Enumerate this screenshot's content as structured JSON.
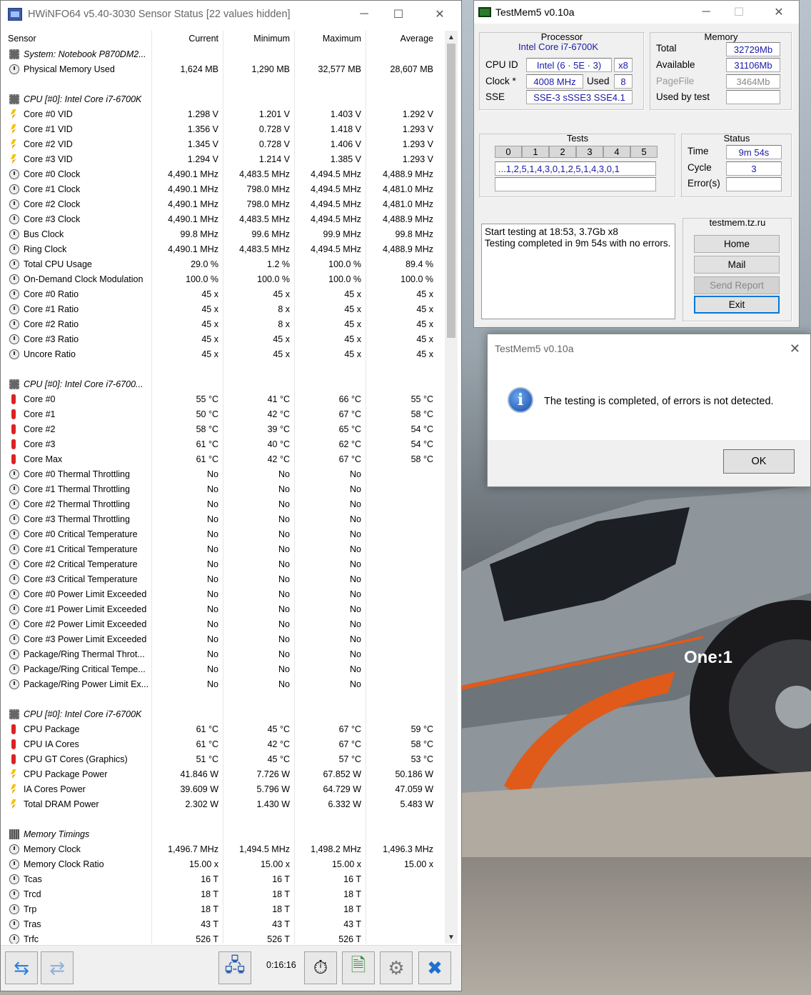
{
  "hwinfo": {
    "title": "HWiNFO64 v5.40-3030 Sensor Status [22 values hidden]",
    "columns": [
      "Sensor",
      "Current",
      "Minimum",
      "Maximum",
      "Average"
    ],
    "uptime": "0:16:16",
    "rows": [
      {
        "type": "group",
        "icon": "chip-icon",
        "name": "System: Notebook P870DM2..."
      },
      {
        "type": "data",
        "icon": "clock-icon",
        "name": "Physical Memory Used",
        "cur": "1,624 MB",
        "min": "1,290 MB",
        "max": "32,577 MB",
        "avg": "28,607 MB"
      },
      {
        "type": "blank"
      },
      {
        "type": "group",
        "icon": "chip-icon",
        "name": "CPU [#0]: Intel Core i7-6700K"
      },
      {
        "type": "data",
        "icon": "voltage-icon",
        "name": "Core #0 VID",
        "cur": "1.298 V",
        "min": "1.201 V",
        "max": "1.403 V",
        "avg": "1.292 V"
      },
      {
        "type": "data",
        "icon": "voltage-icon",
        "name": "Core #1 VID",
        "cur": "1.356 V",
        "min": "0.728 V",
        "max": "1.418 V",
        "avg": "1.293 V"
      },
      {
        "type": "data",
        "icon": "voltage-icon",
        "name": "Core #2 VID",
        "cur": "1.345 V",
        "min": "0.728 V",
        "max": "1.406 V",
        "avg": "1.293 V"
      },
      {
        "type": "data",
        "icon": "voltage-icon",
        "name": "Core #3 VID",
        "cur": "1.294 V",
        "min": "1.214 V",
        "max": "1.385 V",
        "avg": "1.293 V"
      },
      {
        "type": "data",
        "icon": "clock-icon",
        "name": "Core #0 Clock",
        "cur": "4,490.1 MHz",
        "min": "4,483.5 MHz",
        "max": "4,494.5 MHz",
        "avg": "4,488.9 MHz"
      },
      {
        "type": "data",
        "icon": "clock-icon",
        "name": "Core #1 Clock",
        "cur": "4,490.1 MHz",
        "min": "798.0 MHz",
        "max": "4,494.5 MHz",
        "avg": "4,481.0 MHz"
      },
      {
        "type": "data",
        "icon": "clock-icon",
        "name": "Core #2 Clock",
        "cur": "4,490.1 MHz",
        "min": "798.0 MHz",
        "max": "4,494.5 MHz",
        "avg": "4,481.0 MHz"
      },
      {
        "type": "data",
        "icon": "clock-icon",
        "name": "Core #3 Clock",
        "cur": "4,490.1 MHz",
        "min": "4,483.5 MHz",
        "max": "4,494.5 MHz",
        "avg": "4,488.9 MHz"
      },
      {
        "type": "data",
        "icon": "clock-icon",
        "name": "Bus Clock",
        "cur": "99.8 MHz",
        "min": "99.6 MHz",
        "max": "99.9 MHz",
        "avg": "99.8 MHz"
      },
      {
        "type": "data",
        "icon": "clock-icon",
        "name": "Ring Clock",
        "cur": "4,490.1 MHz",
        "min": "4,483.5 MHz",
        "max": "4,494.5 MHz",
        "avg": "4,488.9 MHz"
      },
      {
        "type": "data",
        "icon": "clock-icon",
        "name": "Total CPU Usage",
        "cur": "29.0 %",
        "min": "1.2 %",
        "max": "100.0 %",
        "avg": "89.4 %"
      },
      {
        "type": "data",
        "icon": "clock-icon",
        "name": "On-Demand Clock Modulation",
        "cur": "100.0 %",
        "min": "100.0 %",
        "max": "100.0 %",
        "avg": "100.0 %"
      },
      {
        "type": "data",
        "icon": "clock-icon",
        "name": "Core #0 Ratio",
        "cur": "45 x",
        "min": "45 x",
        "max": "45 x",
        "avg": "45 x"
      },
      {
        "type": "data",
        "icon": "clock-icon",
        "name": "Core #1 Ratio",
        "cur": "45 x",
        "min": "8 x",
        "max": "45 x",
        "avg": "45 x"
      },
      {
        "type": "data",
        "icon": "clock-icon",
        "name": "Core #2 Ratio",
        "cur": "45 x",
        "min": "8 x",
        "max": "45 x",
        "avg": "45 x"
      },
      {
        "type": "data",
        "icon": "clock-icon",
        "name": "Core #3 Ratio",
        "cur": "45 x",
        "min": "45 x",
        "max": "45 x",
        "avg": "45 x"
      },
      {
        "type": "data",
        "icon": "clock-icon",
        "name": "Uncore Ratio",
        "cur": "45 x",
        "min": "45 x",
        "max": "45 x",
        "avg": "45 x"
      },
      {
        "type": "blank"
      },
      {
        "type": "group",
        "icon": "chip-icon",
        "name": "CPU [#0]: Intel Core i7-6700..."
      },
      {
        "type": "data",
        "icon": "temperature-icon",
        "name": "Core #0",
        "cur": "55 °C",
        "min": "41 °C",
        "max": "66 °C",
        "avg": "55 °C"
      },
      {
        "type": "data",
        "icon": "temperature-icon",
        "name": "Core #1",
        "cur": "50 °C",
        "min": "42 °C",
        "max": "67 °C",
        "avg": "58 °C"
      },
      {
        "type": "data",
        "icon": "temperature-icon",
        "name": "Core #2",
        "cur": "58 °C",
        "min": "39 °C",
        "max": "65 °C",
        "avg": "54 °C"
      },
      {
        "type": "data",
        "icon": "temperature-icon",
        "name": "Core #3",
        "cur": "61 °C",
        "min": "40 °C",
        "max": "62 °C",
        "avg": "54 °C"
      },
      {
        "type": "data",
        "icon": "temperature-icon",
        "name": "Core Max",
        "cur": "61 °C",
        "min": "42 °C",
        "max": "67 °C",
        "avg": "58 °C"
      },
      {
        "type": "data",
        "icon": "clock-icon",
        "name": "Core #0 Thermal Throttling",
        "cur": "No",
        "min": "No",
        "max": "No",
        "avg": ""
      },
      {
        "type": "data",
        "icon": "clock-icon",
        "name": "Core #1 Thermal Throttling",
        "cur": "No",
        "min": "No",
        "max": "No",
        "avg": ""
      },
      {
        "type": "data",
        "icon": "clock-icon",
        "name": "Core #2 Thermal Throttling",
        "cur": "No",
        "min": "No",
        "max": "No",
        "avg": ""
      },
      {
        "type": "data",
        "icon": "clock-icon",
        "name": "Core #3 Thermal Throttling",
        "cur": "No",
        "min": "No",
        "max": "No",
        "avg": ""
      },
      {
        "type": "data",
        "icon": "clock-icon",
        "name": "Core #0 Critical Temperature",
        "cur": "No",
        "min": "No",
        "max": "No",
        "avg": ""
      },
      {
        "type": "data",
        "icon": "clock-icon",
        "name": "Core #1 Critical Temperature",
        "cur": "No",
        "min": "No",
        "max": "No",
        "avg": ""
      },
      {
        "type": "data",
        "icon": "clock-icon",
        "name": "Core #2 Critical Temperature",
        "cur": "No",
        "min": "No",
        "max": "No",
        "avg": ""
      },
      {
        "type": "data",
        "icon": "clock-icon",
        "name": "Core #3 Critical Temperature",
        "cur": "No",
        "min": "No",
        "max": "No",
        "avg": ""
      },
      {
        "type": "data",
        "icon": "clock-icon",
        "name": "Core #0 Power Limit Exceeded",
        "cur": "No",
        "min": "No",
        "max": "No",
        "avg": ""
      },
      {
        "type": "data",
        "icon": "clock-icon",
        "name": "Core #1 Power Limit Exceeded",
        "cur": "No",
        "min": "No",
        "max": "No",
        "avg": ""
      },
      {
        "type": "data",
        "icon": "clock-icon",
        "name": "Core #2 Power Limit Exceeded",
        "cur": "No",
        "min": "No",
        "max": "No",
        "avg": ""
      },
      {
        "type": "data",
        "icon": "clock-icon",
        "name": "Core #3 Power Limit Exceeded",
        "cur": "No",
        "min": "No",
        "max": "No",
        "avg": ""
      },
      {
        "type": "data",
        "icon": "clock-icon",
        "name": "Package/Ring Thermal Throt...",
        "cur": "No",
        "min": "No",
        "max": "No",
        "avg": ""
      },
      {
        "type": "data",
        "icon": "clock-icon",
        "name": "Package/Ring Critical Tempe...",
        "cur": "No",
        "min": "No",
        "max": "No",
        "avg": ""
      },
      {
        "type": "data",
        "icon": "clock-icon",
        "name": "Package/Ring Power Limit Ex...",
        "cur": "No",
        "min": "No",
        "max": "No",
        "avg": ""
      },
      {
        "type": "blank"
      },
      {
        "type": "group",
        "icon": "chip-icon",
        "name": "CPU [#0]: Intel Core i7-6700K"
      },
      {
        "type": "data",
        "icon": "temperature-icon",
        "name": "CPU Package",
        "cur": "61 °C",
        "min": "45 °C",
        "max": "67 °C",
        "avg": "59 °C"
      },
      {
        "type": "data",
        "icon": "temperature-icon",
        "name": "CPU IA Cores",
        "cur": "61 °C",
        "min": "42 °C",
        "max": "67 °C",
        "avg": "58 °C"
      },
      {
        "type": "data",
        "icon": "temperature-icon",
        "name": "CPU GT Cores (Graphics)",
        "cur": "51 °C",
        "min": "45 °C",
        "max": "57 °C",
        "avg": "53 °C"
      },
      {
        "type": "data",
        "icon": "voltage-icon",
        "name": "CPU Package Power",
        "cur": "41.846 W",
        "min": "7.726 W",
        "max": "67.852 W",
        "avg": "50.186 W"
      },
      {
        "type": "data",
        "icon": "voltage-icon",
        "name": "IA Cores Power",
        "cur": "39.609 W",
        "min": "5.796 W",
        "max": "64.729 W",
        "avg": "47.059 W"
      },
      {
        "type": "data",
        "icon": "voltage-icon",
        "name": "Total DRAM Power",
        "cur": "2.302 W",
        "min": "1.430 W",
        "max": "6.332 W",
        "avg": "5.483 W"
      },
      {
        "type": "blank"
      },
      {
        "type": "group",
        "icon": "memory-icon",
        "name": "Memory Timings"
      },
      {
        "type": "data",
        "icon": "clock-icon",
        "name": "Memory Clock",
        "cur": "1,496.7 MHz",
        "min": "1,494.5 MHz",
        "max": "1,498.2 MHz",
        "avg": "1,496.3 MHz"
      },
      {
        "type": "data",
        "icon": "clock-icon",
        "name": "Memory Clock Ratio",
        "cur": "15.00 x",
        "min": "15.00 x",
        "max": "15.00 x",
        "avg": "15.00 x"
      },
      {
        "type": "data",
        "icon": "clock-icon",
        "name": "Tcas",
        "cur": "16 T",
        "min": "16 T",
        "max": "16 T",
        "avg": ""
      },
      {
        "type": "data",
        "icon": "clock-icon",
        "name": "Trcd",
        "cur": "18 T",
        "min": "18 T",
        "max": "18 T",
        "avg": ""
      },
      {
        "type": "data",
        "icon": "clock-icon",
        "name": "Trp",
        "cur": "18 T",
        "min": "18 T",
        "max": "18 T",
        "avg": ""
      },
      {
        "type": "data",
        "icon": "clock-icon",
        "name": "Tras",
        "cur": "43 T",
        "min": "43 T",
        "max": "43 T",
        "avg": ""
      },
      {
        "type": "data",
        "icon": "clock-icon",
        "name": "Trfc",
        "cur": "526 T",
        "min": "526 T",
        "max": "526 T",
        "avg": ""
      }
    ]
  },
  "testmem": {
    "title": "TestMem5 v0.10a",
    "processor": {
      "heading": "Processor",
      "name": "Intel Core i7-6700K",
      "cpuid_label": "CPU ID",
      "cpuid_value": "Intel  (6 · 5E · 3)",
      "threads": "x8",
      "clock_label": "Clock *",
      "clock_value": "4008 MHz",
      "used_label": "Used",
      "used_value": "8",
      "sse_label": "SSE",
      "sse_value": "SSE-3 sSSE3 SSE4.1"
    },
    "memory": {
      "heading": "Memory",
      "total_label": "Total",
      "total_value": "32729Mb",
      "available_label": "Available",
      "available_value": "31106Mb",
      "pagefile_label": "PageFile",
      "pagefile_value": "3464Mb",
      "usedbytest_label": "Used by test",
      "usedbytest_value": ""
    },
    "tests": {
      "heading": "Tests",
      "numbers": [
        "0",
        "1",
        "2",
        "3",
        "4",
        "5"
      ],
      "sequence": "...1,2,5,1,4,3,0,1,2,5,1,4,3,0,1"
    },
    "status": {
      "heading": "Status",
      "time_label": "Time",
      "time_value": "9m 54s",
      "cycle_label": "Cycle",
      "cycle_value": "3",
      "errors_label": "Error(s)",
      "errors_value": ""
    },
    "log": [
      "Start testing at 18:53, 3.7Gb x8",
      "Testing completed in 9m 54s with no errors."
    ],
    "site": "testmem.tz.ru",
    "buttons": {
      "home": "Home",
      "mail": "Mail",
      "send_report": "Send Report",
      "exit": "Exit"
    }
  },
  "dialog": {
    "title": "TestMem5 v0.10a",
    "message": "The testing is completed, of errors is not detected.",
    "ok": "OK"
  },
  "wallpaper": {
    "badge": "One:1"
  }
}
